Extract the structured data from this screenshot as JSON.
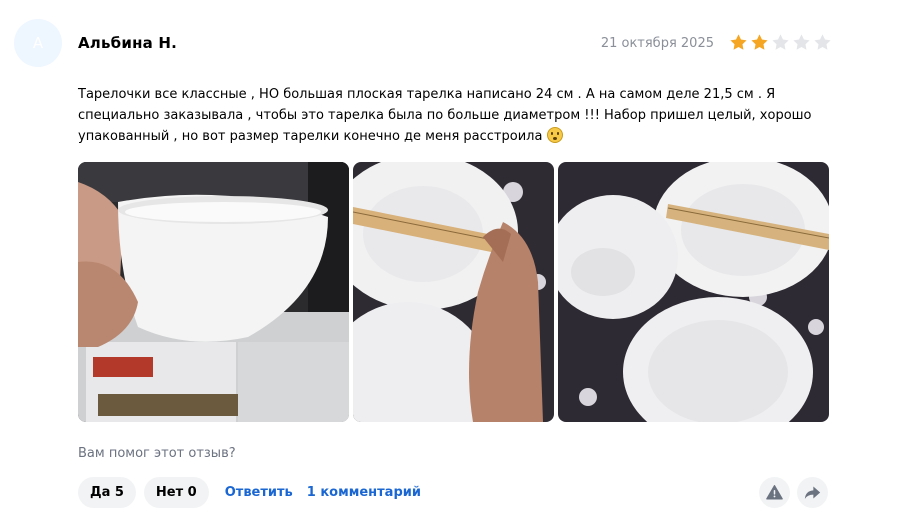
{
  "review": {
    "avatar_letter": "А",
    "author": "Альбина Н.",
    "date": "21 октября 2025",
    "rating": 2,
    "rating_max": 5,
    "star_filled_color": "#f5a623",
    "star_empty_color": "#e3e5e8",
    "text": "Тарелочки все классные , НО большая плоская тарелка написано 24 см . А на самом деле 21,5 см . Я специально заказывала , чтобы это тарелка была по больше диаметром !!! Набор пришел целый, хорошо упакованный , но вот размер тарелки конечно де меня расстроила",
    "emoji": "disappointed-face-emoji"
  },
  "feedback": {
    "question": "Вам помог этот отзыв?",
    "yes_label": "Да 5",
    "no_label": "Нет 0",
    "reply_label": "Ответить",
    "comments_label": "1 комментарий"
  },
  "icons": {
    "report": "warning-icon",
    "share": "share-arrow-icon"
  },
  "colors": {
    "link": "#1a66d2",
    "pill_bg": "#f2f3f5",
    "muted_text": "#8a8f98"
  }
}
